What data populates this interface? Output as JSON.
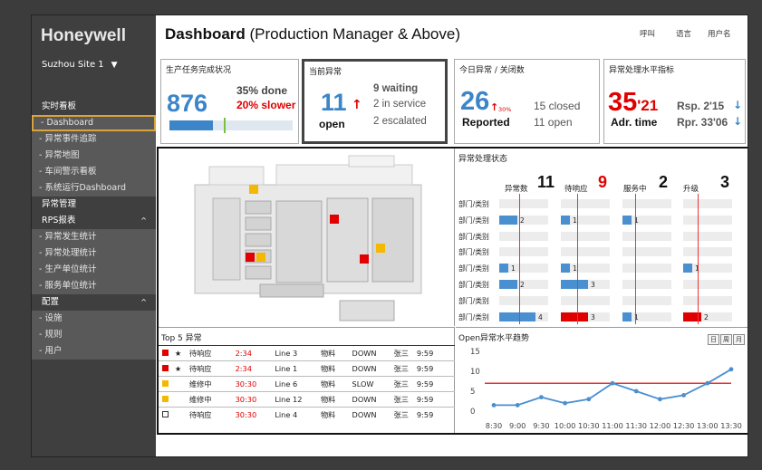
{
  "sidebar": {
    "brand": "Honeywell",
    "site": "Suzhou Site 1",
    "sections": [
      {
        "label": "实时看板",
        "items": [
          "- Dashboard",
          "- 异常事件追踪",
          "- 异常地图",
          "- 车间警示看板",
          "- 系统运行Dashboard"
        ]
      },
      {
        "label": "异常管理"
      },
      {
        "label": "RPS报表",
        "items": [
          "- 异常发生统计",
          "- 异常处理统计",
          "- 生产单位统计",
          "- 服务单位统计"
        ]
      },
      {
        "label": "配置",
        "items": [
          "- 设施",
          "- 规则",
          "- 用户"
        ]
      }
    ],
    "active": "- Dashboard"
  },
  "header": {
    "title_bold": "Dashboard",
    "title_rest": " (Production Manager & Above)",
    "links": [
      "呼叫",
      "语言",
      "用户名"
    ]
  },
  "kpi": {
    "production": {
      "title": "生产任务完成状况",
      "value": "876",
      "done": "35% done",
      "slower": "20% slower",
      "progress": 0.35
    },
    "current": {
      "title": "当前异常",
      "value": "11",
      "open_label": "open",
      "waiting": "9 waiting",
      "in_service": "2 in service",
      "escalated": "2 escalated"
    },
    "today": {
      "title": "今日异常 / 关闭数",
      "value": "26",
      "pct": "30%",
      "reported_label": "Reported",
      "closed": "15 closed",
      "open": "11 open"
    },
    "handling": {
      "title": "异常处理水平指标",
      "value_main": "35",
      "value_sub": "'21",
      "adr_label": "Adr. time",
      "rsp": "Rsp. 2'15",
      "rpr": "Rpr. 33'06"
    }
  },
  "status": {
    "title": "异常处理状态",
    "counts": [
      {
        "label": "异常数",
        "value": "11",
        "color": "#111111"
      },
      {
        "label": "待响应",
        "value": "9",
        "color": "#e00000"
      },
      {
        "label": "服务中",
        "value": "2",
        "color": "#111111"
      },
      {
        "label": "升级",
        "value": "3",
        "color": "#111111"
      }
    ],
    "row_label": "部门/类别",
    "columns": [
      {
        "values": [
          0,
          2,
          0,
          0,
          1,
          2,
          0,
          4
        ],
        "red_rows": []
      },
      {
        "values": [
          0,
          1,
          0,
          0,
          1,
          3,
          0,
          3
        ],
        "red_rows": [
          7
        ]
      },
      {
        "values": [
          0,
          1,
          0,
          0,
          0,
          0,
          0,
          1
        ],
        "red_rows": []
      },
      {
        "values": [
          0,
          0,
          0,
          0,
          1,
          0,
          0,
          2
        ],
        "red_rows": [
          7
        ]
      }
    ]
  },
  "map": {
    "markers": [
      {
        "color": "#f5b800"
      },
      {
        "color": "#e00000"
      },
      {
        "color": "#f5b800"
      },
      {
        "color": "#e00000"
      },
      {
        "color": "#f5b800"
      },
      {
        "color": "#e00000"
      }
    ]
  },
  "top5": {
    "title": "Top 5 异常",
    "rows": [
      {
        "marker": "red",
        "star": "★",
        "status": "待响应",
        "time": "2:34",
        "line": "Line 3",
        "type": "物料",
        "state": "DOWN",
        "person": "张三",
        "clock": "9:59"
      },
      {
        "marker": "red",
        "star": "★",
        "status": "待响应",
        "time": "2:34",
        "line": "Line 1",
        "type": "物料",
        "state": "DOWN",
        "person": "张三",
        "clock": "9:59"
      },
      {
        "marker": "yellow",
        "star": "",
        "status": "维修中",
        "time": "30:30",
        "line": "Line 6",
        "type": "物料",
        "state": "SLOW",
        "person": "张三",
        "clock": "9:59"
      },
      {
        "marker": "yellow",
        "star": "",
        "status": "维修中",
        "time": "30:30",
        "line": "Line 12",
        "type": "物料",
        "state": "DOWN",
        "person": "张三",
        "clock": "9:59"
      },
      {
        "marker": "empty",
        "star": "",
        "status": "待响应",
        "time": "30:30",
        "line": "Line 4",
        "type": "物料",
        "state": "DOWN",
        "person": "张三",
        "clock": "9:59"
      }
    ]
  },
  "trend": {
    "title": "Open异常水平趋势",
    "buttons": [
      "日",
      "周",
      "月"
    ]
  },
  "chart_data": {
    "type": "line",
    "x": [
      "8:30",
      "9:00",
      "9:30",
      "10:00",
      "10:30",
      "11:00",
      "11:30",
      "12:00",
      "12:30",
      "13:00",
      "13:30"
    ],
    "series": [
      {
        "values": [
          1.5,
          1.5,
          3.5,
          2,
          3,
          7,
          5,
          3,
          4,
          7,
          10.5
        ]
      }
    ],
    "threshold": 7,
    "yticks": [
      0,
      5,
      10,
      15
    ],
    "ylim": [
      0,
      15
    ],
    "colors": {
      "line": "#4a8fd0",
      "threshold": "#e33333"
    }
  }
}
